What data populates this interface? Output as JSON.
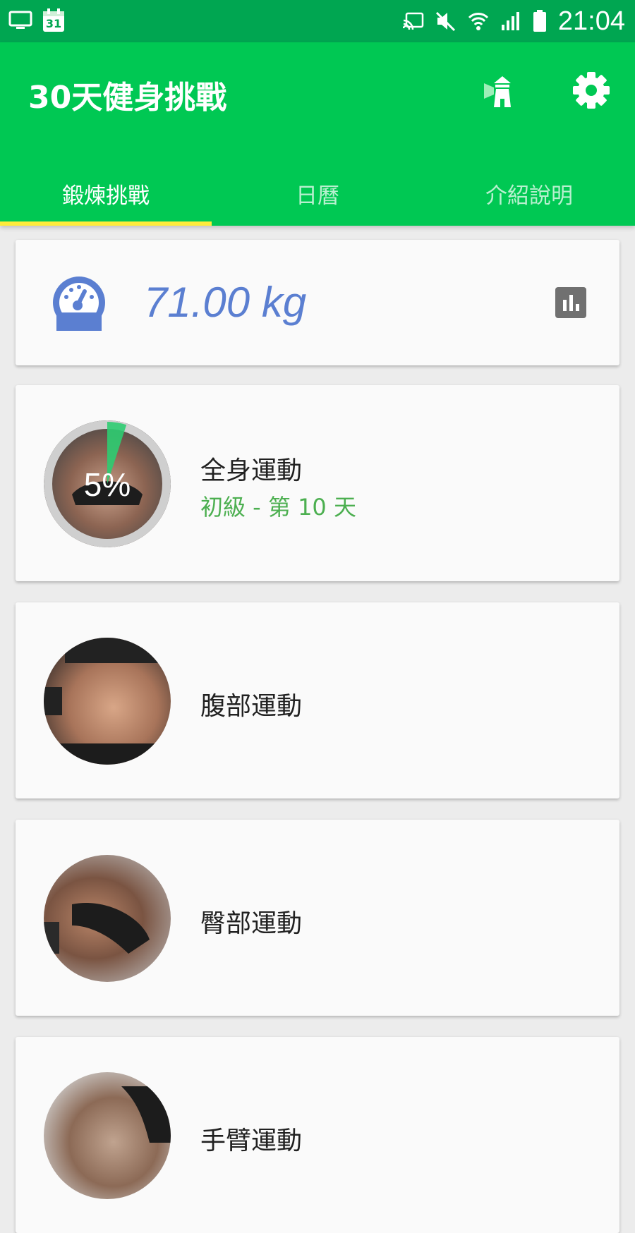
{
  "status_bar": {
    "time": "21:04",
    "calendar_day": "31",
    "icons": [
      "screen-icon",
      "calendar-icon",
      "cast-icon",
      "mute-icon",
      "wifi-icon",
      "signal-icon",
      "battery-icon"
    ]
  },
  "app_bar": {
    "title": "30天健身挑戰",
    "actions": [
      "lighthouse-icon",
      "gear-icon"
    ]
  },
  "tabs": [
    {
      "label": "鍛煉挑戰",
      "active": true
    },
    {
      "label": "日曆",
      "active": false
    },
    {
      "label": "介紹說明",
      "active": false
    }
  ],
  "weight": {
    "value": "71.00 kg"
  },
  "workouts": [
    {
      "title": "全身運動",
      "subtitle": "初級 - 第 10 天",
      "progress_label": "5%",
      "progress": 0.05
    },
    {
      "title": "腹部運動"
    },
    {
      "title": "臀部運動"
    },
    {
      "title": "手臂運動"
    }
  ],
  "colors": {
    "primary": "#00c853",
    "primary_dark": "#00a651",
    "tab_indicator": "#ffeb3b",
    "weight_text": "#5b7fd1",
    "subtitle": "#4caf50",
    "progress_wedge": "#2ecc71"
  }
}
